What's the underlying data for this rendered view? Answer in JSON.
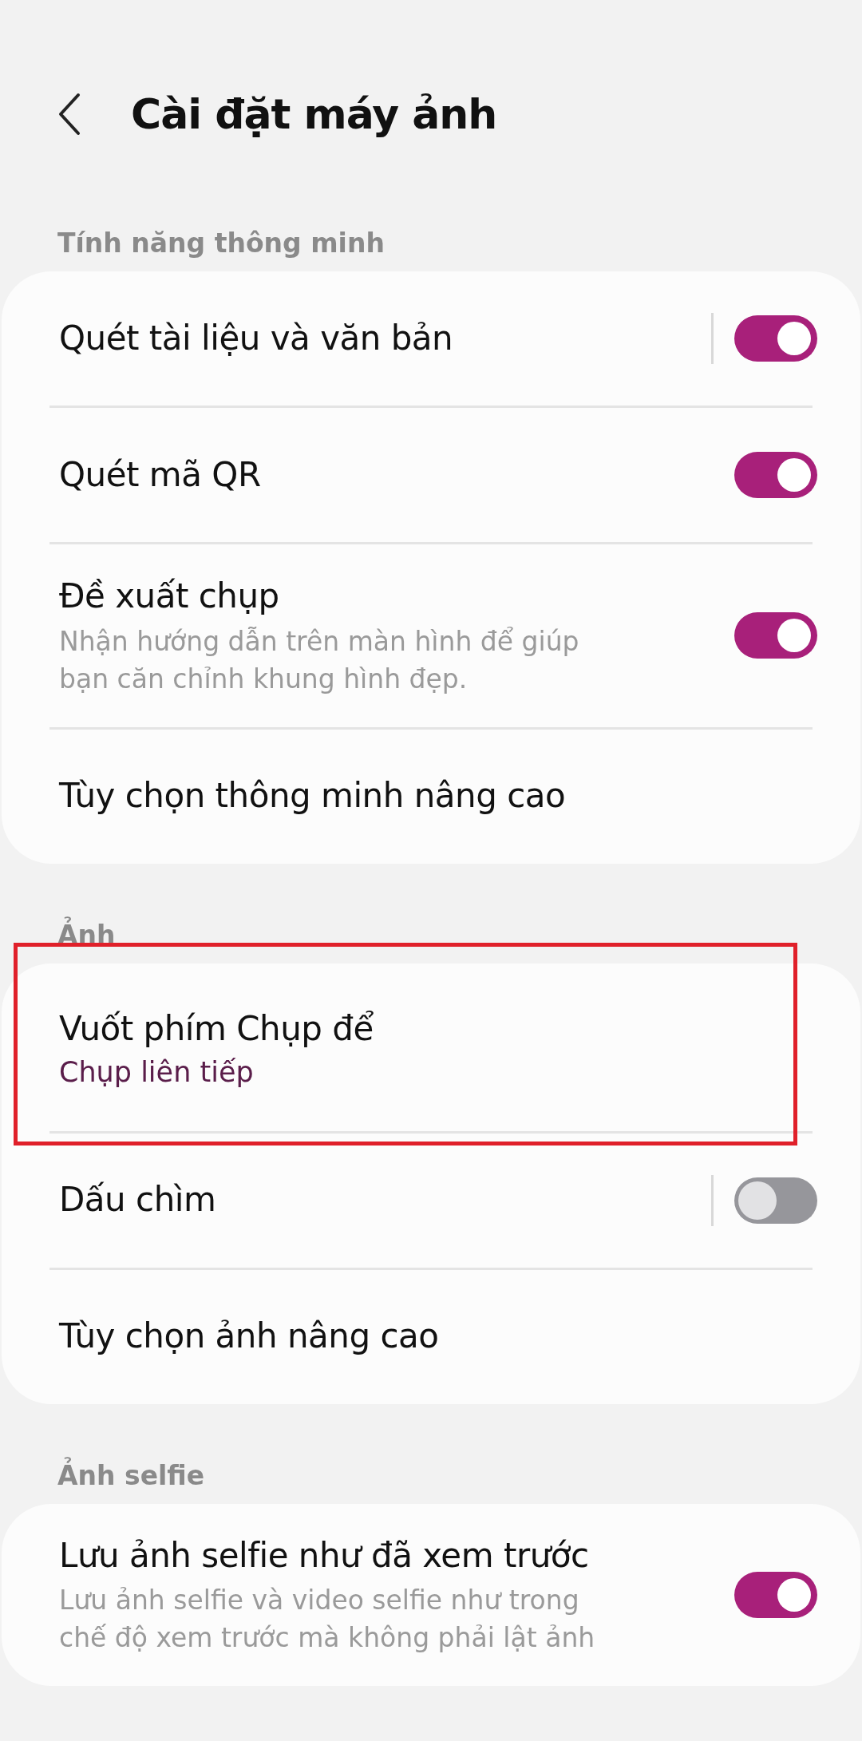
{
  "header": {
    "title": "Cài đặt máy ảnh"
  },
  "sections": [
    {
      "label": "Tính năng thông minh",
      "rows": [
        {
          "kind": "toggle",
          "title": "Quét tài liệu và văn bản",
          "on": true,
          "separator": true
        },
        {
          "kind": "toggle",
          "title": "Quét mã QR",
          "on": true,
          "separator": false
        },
        {
          "kind": "toggle",
          "title": "Đề xuất chụp",
          "description": "Nhận hướng dẫn trên màn hình để giúp bạn căn chỉnh khung hình đẹp.",
          "on": true,
          "separator": false
        },
        {
          "kind": "link",
          "title": "Tùy chọn thông minh nâng cao"
        }
      ]
    },
    {
      "label": "Ảnh",
      "rows": [
        {
          "kind": "value",
          "title": "Vuốt phím Chụp để",
          "value": "Chụp liên tiếp",
          "highlighted": true
        },
        {
          "kind": "toggle",
          "title": "Dấu chìm",
          "on": false,
          "separator": true
        },
        {
          "kind": "link",
          "title": "Tùy chọn ảnh nâng cao"
        }
      ]
    },
    {
      "label": "Ảnh selfie",
      "rows": [
        {
          "kind": "toggle",
          "title": "Lưu ảnh selfie như đã xem trước",
          "description": "Lưu ảnh selfie và video selfie như trong chế độ xem trước mà không phải lật ảnh",
          "on": true,
          "separator": false
        }
      ]
    }
  ]
}
